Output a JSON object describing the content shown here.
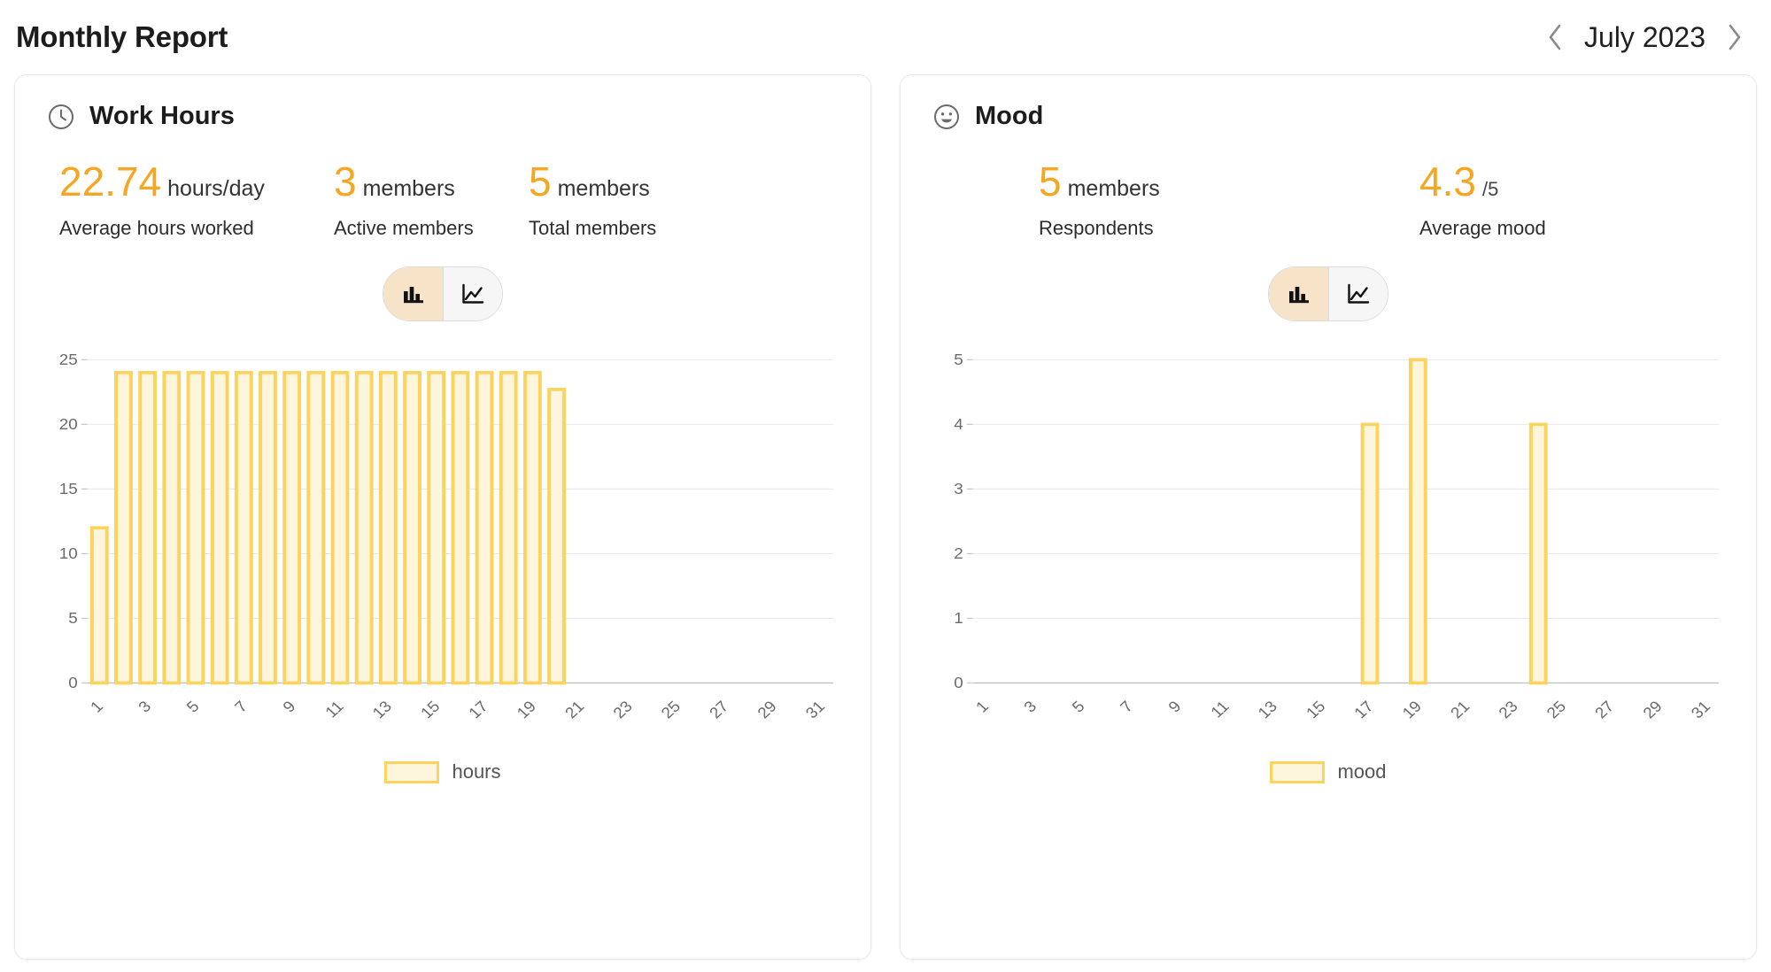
{
  "header": {
    "title": "Monthly Report",
    "date_label": "July 2023",
    "prev_icon": "chevron-left-icon",
    "next_icon": "chevron-right-icon"
  },
  "cards": [
    {
      "id": "work-hours",
      "icon": "clock-icon",
      "title": "Work Hours",
      "stats": [
        {
          "value": "22.74",
          "unit": "hours/day",
          "label": "Average hours worked"
        },
        {
          "value": "3",
          "unit": "members",
          "label": "Active members"
        },
        {
          "value": "5",
          "unit": "members",
          "label": "Total members"
        }
      ],
      "toggle": {
        "bar_icon": "bar-chart-icon",
        "line_icon": "line-chart-icon",
        "selected": "bar"
      },
      "legend_label": "hours"
    },
    {
      "id": "mood",
      "icon": "smiley-icon",
      "title": "Mood",
      "stats": [
        {
          "value": "5",
          "unit": "members",
          "label": "Respondents"
        },
        {
          "value": "4.3",
          "unit": "/5",
          "label": "Average mood"
        }
      ],
      "toggle": {
        "bar_icon": "bar-chart-icon",
        "line_icon": "line-chart-icon",
        "selected": "bar"
      },
      "legend_label": "mood"
    }
  ],
  "chart_data": [
    {
      "type": "bar",
      "id": "work-hours-chart",
      "title": "Work Hours",
      "xlabel": "",
      "ylabel": "",
      "ylim": [
        0,
        25
      ],
      "yticks": [
        0,
        5,
        10,
        15,
        20,
        25
      ],
      "xticks": [
        1,
        3,
        5,
        7,
        9,
        11,
        13,
        15,
        17,
        19,
        21,
        23,
        25,
        27,
        29,
        31
      ],
      "grid": true,
      "legend": [
        "hours"
      ],
      "legend_position": "bottom",
      "series_name": "hours",
      "categories": [
        1,
        2,
        3,
        4,
        5,
        6,
        7,
        8,
        9,
        10,
        11,
        12,
        13,
        14,
        15,
        16,
        17,
        18,
        19,
        20,
        21,
        22,
        23,
        24,
        25,
        26,
        27,
        28,
        29,
        30,
        31
      ],
      "values": [
        12,
        24,
        24,
        24,
        24,
        24,
        24,
        24,
        24,
        24,
        24,
        24,
        24,
        24,
        24,
        24,
        24,
        24,
        24,
        22.7,
        0,
        0,
        0,
        0,
        0,
        0,
        0,
        0,
        0,
        0,
        0
      ],
      "bar_fill": "#fdf5dc",
      "bar_stroke": "#fbd35d"
    },
    {
      "type": "bar",
      "id": "mood-chart",
      "title": "Mood",
      "xlabel": "",
      "ylabel": "",
      "ylim": [
        0,
        5
      ],
      "yticks": [
        0,
        1,
        2,
        3,
        4,
        5
      ],
      "xticks": [
        1,
        3,
        5,
        7,
        9,
        11,
        13,
        15,
        17,
        19,
        21,
        23,
        25,
        27,
        29,
        31
      ],
      "grid": true,
      "legend": [
        "mood"
      ],
      "legend_position": "bottom",
      "series_name": "mood",
      "categories": [
        1,
        2,
        3,
        4,
        5,
        6,
        7,
        8,
        9,
        10,
        11,
        12,
        13,
        14,
        15,
        16,
        17,
        18,
        19,
        20,
        21,
        22,
        23,
        24,
        25,
        26,
        27,
        28,
        29,
        30,
        31
      ],
      "values": [
        0,
        0,
        0,
        0,
        0,
        0,
        0,
        0,
        0,
        0,
        0,
        0,
        0,
        0,
        0,
        0,
        4,
        0,
        5,
        0,
        0,
        0,
        0,
        4,
        0,
        0,
        0,
        0,
        0,
        0,
        0
      ],
      "bar_fill": "#fdf5dc",
      "bar_stroke": "#fbd35d"
    }
  ],
  "colors": {
    "accent": "#f5a623",
    "bar_fill": "#fdf5dc",
    "bar_stroke": "#fbd35d",
    "toggle_active_bg": "#f7e3c8",
    "card_border": "#e9e9e9"
  }
}
